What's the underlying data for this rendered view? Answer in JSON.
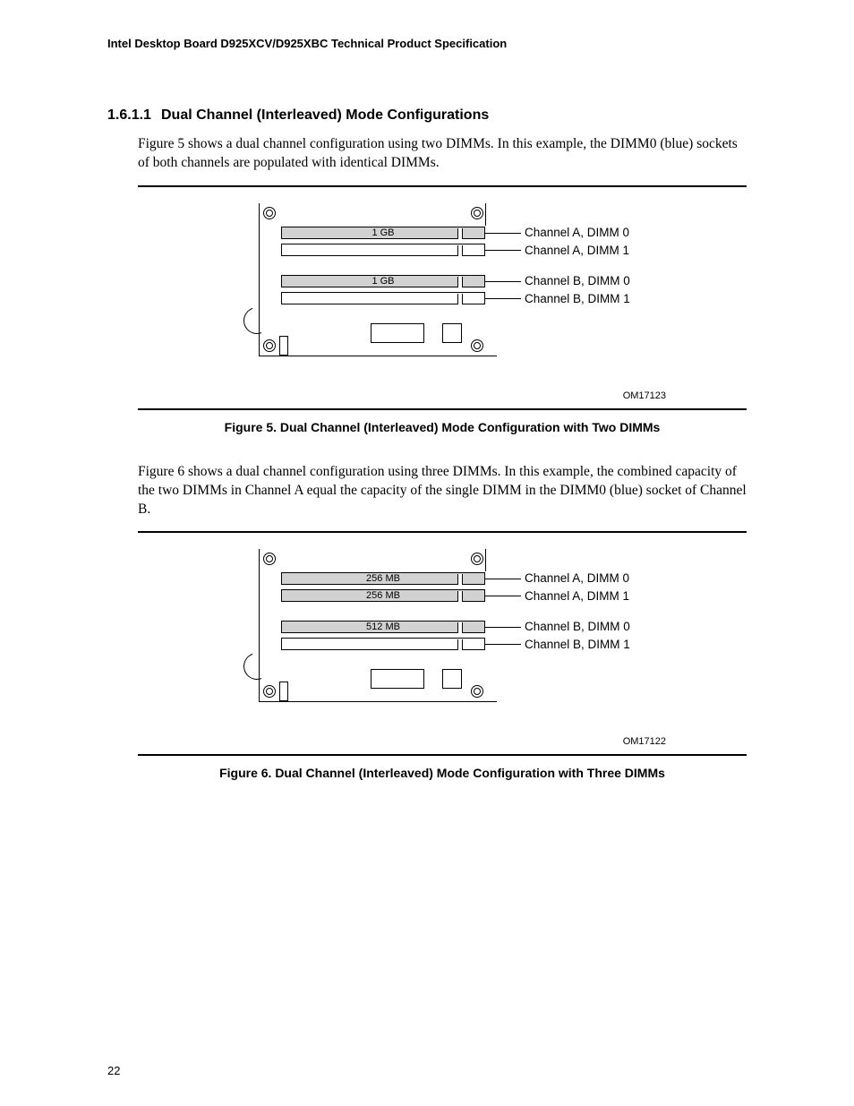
{
  "header": "Intel Desktop Board D925XCV/D925XBC Technical Product Specification",
  "section": {
    "number": "1.6.1.1",
    "title": "Dual Channel (Interleaved) Mode Configurations"
  },
  "para1": "Figure 5 shows a dual channel configuration using two DIMMs.  In this example, the DIMM0 (blue) sockets of both channels are populated with identical DIMMs.",
  "para2": "Figure 6 shows a dual channel configuration using three DIMMs.  In this example, the combined capacity of the two DIMMs in Channel A equal the capacity of the single DIMM in the DIMM0 (blue) socket of Channel B.",
  "fig5": {
    "slots": {
      "a0": {
        "size": "1 GB",
        "filled": true,
        "label": "Channel A, DIMM 0"
      },
      "a1": {
        "size": "",
        "filled": false,
        "label": "Channel A, DIMM 1"
      },
      "b0": {
        "size": "1 GB",
        "filled": true,
        "label": "Channel B, DIMM 0"
      },
      "b1": {
        "size": "",
        "filled": false,
        "label": "Channel B, DIMM 1"
      }
    },
    "om": "OM17123",
    "caption": "Figure 5.  Dual Channel (Interleaved) Mode Configuration with Two DIMMs"
  },
  "fig6": {
    "slots": {
      "a0": {
        "size": "256 MB",
        "filled": true,
        "label": "Channel A, DIMM 0"
      },
      "a1": {
        "size": "256 MB",
        "filled": true,
        "label": "Channel A, DIMM 1"
      },
      "b0": {
        "size": "512 MB",
        "filled": true,
        "label": "Channel B, DIMM 0"
      },
      "b1": {
        "size": "",
        "filled": false,
        "label": "Channel B, DIMM 1"
      }
    },
    "om": "OM17122",
    "caption": "Figure 6.  Dual Channel (Interleaved) Mode Configuration with Three DIMMs"
  },
  "page": "22"
}
